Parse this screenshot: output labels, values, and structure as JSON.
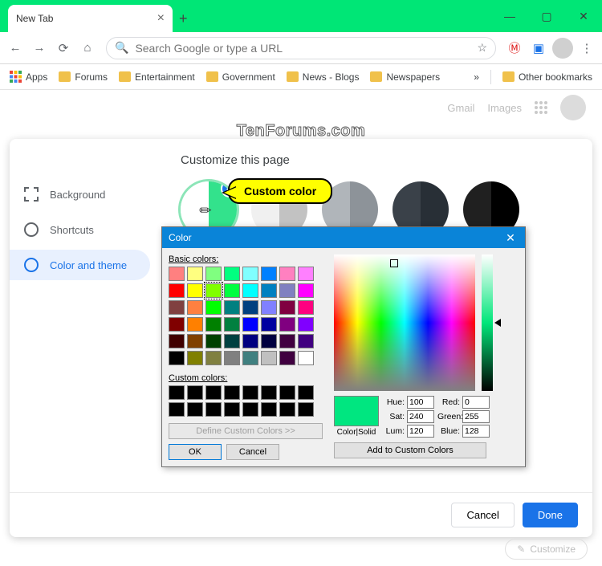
{
  "window": {
    "tab_title": "New Tab"
  },
  "omnibox": {
    "placeholder": "Search Google or type a URL"
  },
  "bookmarks": {
    "apps": "Apps",
    "items": [
      "Forums",
      "Entertainment",
      "Government",
      "News - Blogs",
      "Newspapers"
    ],
    "other": "Other bookmarks"
  },
  "ntp": {
    "gmail": "Gmail",
    "images": "Images"
  },
  "watermark": "TenForums.com",
  "dialog": {
    "title": "Customize this page",
    "sidebar": {
      "background": "Background",
      "shortcuts": "Shortcuts",
      "color": "Color and theme"
    },
    "swatches": [
      {
        "l": "#ffffff",
        "r": "#33e28c",
        "selected": true,
        "custom": true
      },
      {
        "l": "#f0f0f0",
        "r": "#c2c2c2"
      },
      {
        "l": "#b0b5ba",
        "r": "#8d9399"
      },
      {
        "l": "#3a4149",
        "r": "#282f36"
      },
      {
        "l": "#202020",
        "r": "#000000"
      },
      {
        "l": "#ffffff",
        "r": "#ffffff"
      },
      {
        "l": "#ffe1dc",
        "r": "#f3bcb2"
      },
      {
        "l": "#f7c4d6",
        "r": "#ffb6c1"
      },
      {
        "l": "#7a3ccf",
        "r": "#5b2aa0"
      },
      {
        "l": "#4a1f9c",
        "r": "#2f0f75"
      }
    ],
    "footer": {
      "cancel": "Cancel",
      "done": "Done"
    }
  },
  "callout": "Custom color",
  "colorpicker": {
    "title": "Color",
    "basic_label": "Basic colors:",
    "basic_colors": [
      "#ff8080",
      "#ffff80",
      "#80ff80",
      "#00ff80",
      "#80ffff",
      "#0080ff",
      "#ff80c0",
      "#ff80ff",
      "#ff0000",
      "#ffff00",
      "#80ff00",
      "#00ff40",
      "#00ffff",
      "#0080c0",
      "#8080c0",
      "#ff00ff",
      "#804040",
      "#ff8040",
      "#00ff00",
      "#008080",
      "#004080",
      "#8080ff",
      "#800040",
      "#ff0080",
      "#800000",
      "#ff8000",
      "#008000",
      "#008040",
      "#0000ff",
      "#0000a0",
      "#800080",
      "#8000ff",
      "#400000",
      "#804000",
      "#004000",
      "#004040",
      "#000080",
      "#000040",
      "#400040",
      "#400080",
      "#000000",
      "#808000",
      "#808040",
      "#808080",
      "#408080",
      "#c0c0c0",
      "#400040",
      "#ffffff"
    ],
    "selected_basic_index": 10,
    "custom_label": "Custom colors:",
    "define": "Define Custom Colors >>",
    "ok": "OK",
    "cancel": "Cancel",
    "colorsolid": "Color|Solid",
    "hue_label": "Hue:",
    "sat_label": "Sat:",
    "lum_label": "Lum:",
    "red_label": "Red:",
    "green_label": "Green:",
    "blue_label": "Blue:",
    "hue": "100",
    "sat": "240",
    "lum": "120",
    "red": "0",
    "green": "255",
    "blue": "128",
    "add": "Add to Custom Colors"
  },
  "customize_button": "Customize"
}
